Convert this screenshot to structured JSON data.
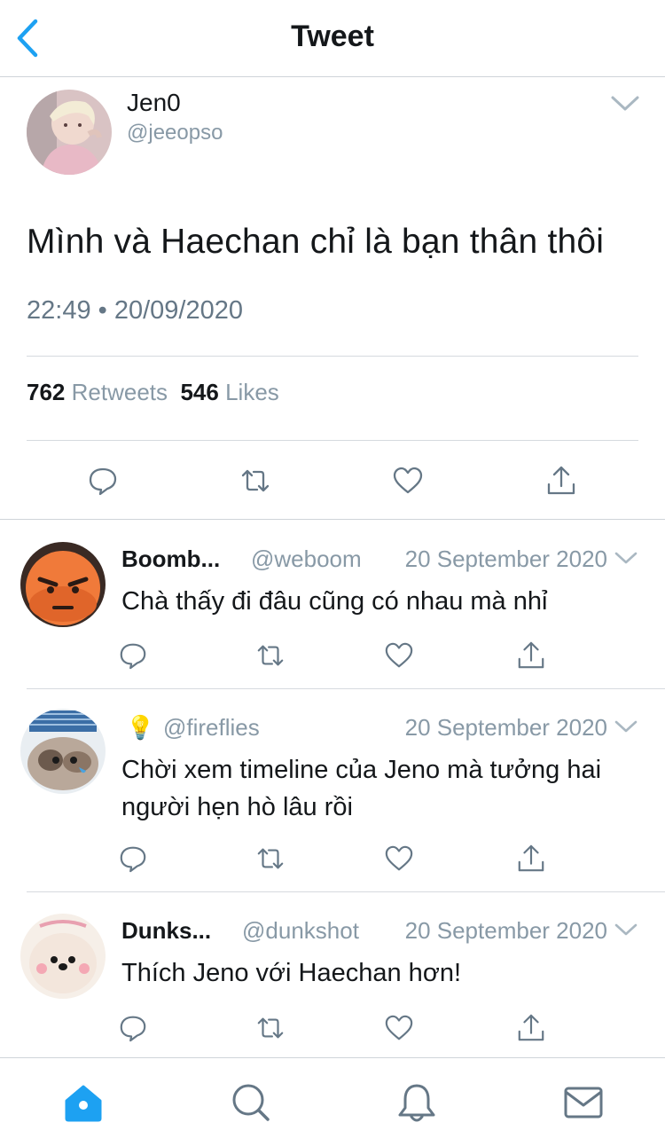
{
  "nav": {
    "title": "Tweet"
  },
  "tweet": {
    "name": "Jen0",
    "handle": "@jeeopso",
    "text": "Mình và Haechan chỉ là bạn thân thôi",
    "time": "22:49 • 20/09/2020",
    "retweets_count": "762",
    "retweets_label": "Retweets",
    "likes_count": "546",
    "likes_label": "Likes"
  },
  "replies": [
    {
      "name": "Boomb...",
      "handle": "@weboom",
      "date": "20 September 2020",
      "text": "Chà thấy đi đâu cũng có nhau mà nhỉ"
    },
    {
      "name": "💡",
      "handle": "@fireflies",
      "date": "20 September 2020",
      "text": "Chời xem timeline của Jeno mà tưởng hai người hẹn hò lâu rồi"
    },
    {
      "name": "Dunks...",
      "handle": "@dunkshot",
      "date": "20 September 2020",
      "text": "Thích Jeno với Haechan hơn!"
    }
  ],
  "icons": {
    "back": "chevron-left-icon",
    "more": "chevron-down-icon",
    "reply": "comment-icon",
    "retweet": "retweet-icon",
    "like": "heart-icon",
    "share": "share-icon",
    "tabs": [
      "home-icon",
      "search-icon",
      "bell-icon",
      "mail-icon"
    ]
  },
  "colors": {
    "accent": "#1da1f2",
    "icon_gray": "#657786",
    "secondary_text": "#8899a6"
  }
}
